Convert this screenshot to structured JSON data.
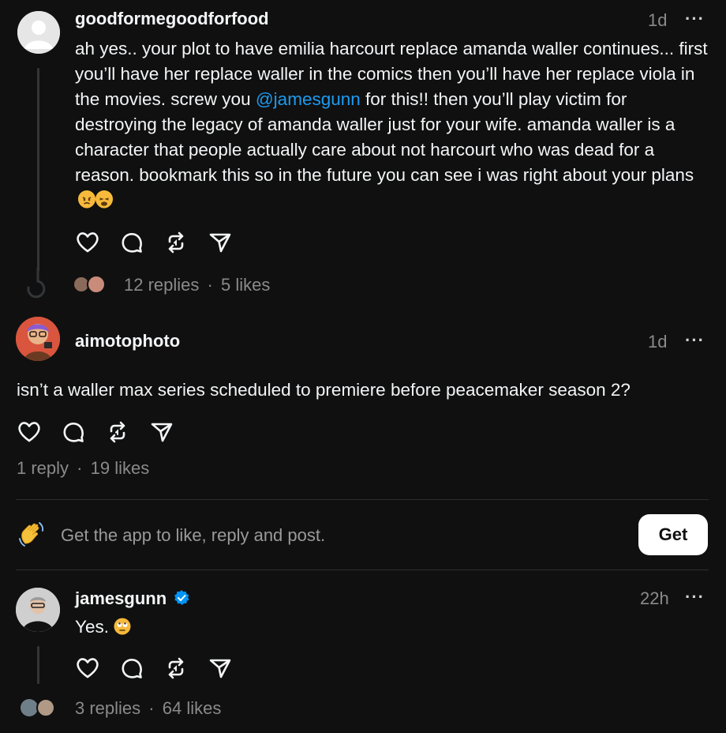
{
  "posts": [
    {
      "username": "goodformegoodforfood",
      "time": "1d",
      "text_before": "ah yes.. your plot to have emilia harcourt replace amanda waller continues... first you’ll have her replace waller in the comics then you’ll have her replace viola in the movies. screw you ",
      "mention": "@jamesgunn",
      "text_after": " for this!! then you’ll play victim for destroying the legacy of amanda waller just for your wife. amanda waller is a character that people actually care about not harcourt who was dead for a reason. bookmark this so in the future you can see i was right about your plans",
      "replies": "12 replies",
      "likes": "5 likes"
    },
    {
      "username": "aimotophoto",
      "time": "1d",
      "text": "isn’t a waller max series scheduled to premiere before peacemaker season 2?",
      "replies": "1 reply",
      "likes": "19 likes"
    },
    {
      "username": "jamesgunn",
      "verified": true,
      "time": "22h",
      "text": "Yes.",
      "replies": "3 replies",
      "likes": "64 likes"
    }
  ],
  "menu_label": "···",
  "separator": "·",
  "promo": {
    "text": "Get the app to like, reply and post.",
    "button": "Get"
  },
  "icons": [
    "heart-icon",
    "comment-icon",
    "repost-icon",
    "share-icon",
    "verified-badge-icon",
    "wave-emoji",
    "angry-emoji",
    "weary-emoji",
    "eyeroll-emoji"
  ],
  "colors": {
    "background": "#101010",
    "text": "#f3f5f7",
    "muted": "#8a8a8a",
    "mention": "#1d9bf0",
    "verified": "#0095f6"
  }
}
